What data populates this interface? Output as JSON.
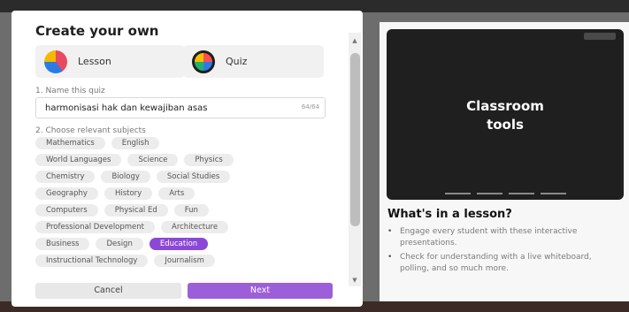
{
  "modal": {
    "title": "Create your own",
    "types": [
      {
        "label": "Lesson",
        "icon": "lesson-icon"
      },
      {
        "label": "Quiz",
        "icon": "quiz-icon"
      }
    ],
    "step1_label": "1. Name this quiz",
    "name_value": "harmonisasi hak dan kewajiban asas",
    "char_count": "64/64",
    "step2_label": "2. Choose relevant subjects",
    "subject_rows": [
      [
        "Mathematics",
        "English"
      ],
      [
        "World Languages",
        "Science",
        "Physics"
      ],
      [
        "Chemistry",
        "Biology",
        "Social Studies"
      ],
      [
        "Geography",
        "History",
        "Arts"
      ],
      [
        "Computers",
        "Physical Ed",
        "Fun"
      ],
      [
        "Professional Development",
        "Architecture"
      ],
      [
        "Business",
        "Design",
        "Education"
      ],
      [
        "Instructional Technology",
        "Journalism"
      ]
    ],
    "selected_subject": "Education",
    "cancel_label": "Cancel",
    "next_label": "Next"
  },
  "preview": {
    "video_title_line1": "Classroom",
    "video_title_line2": "tools",
    "heading": "What's in a lesson?",
    "bullets": [
      "Engage every student with these interactive presentations.",
      "Check for understanding with a live whiteboard, polling, and so much more."
    ]
  },
  "colors": {
    "accent": "#8b48d6",
    "next_button": "#9d5ed9",
    "chip": "#ececec"
  }
}
